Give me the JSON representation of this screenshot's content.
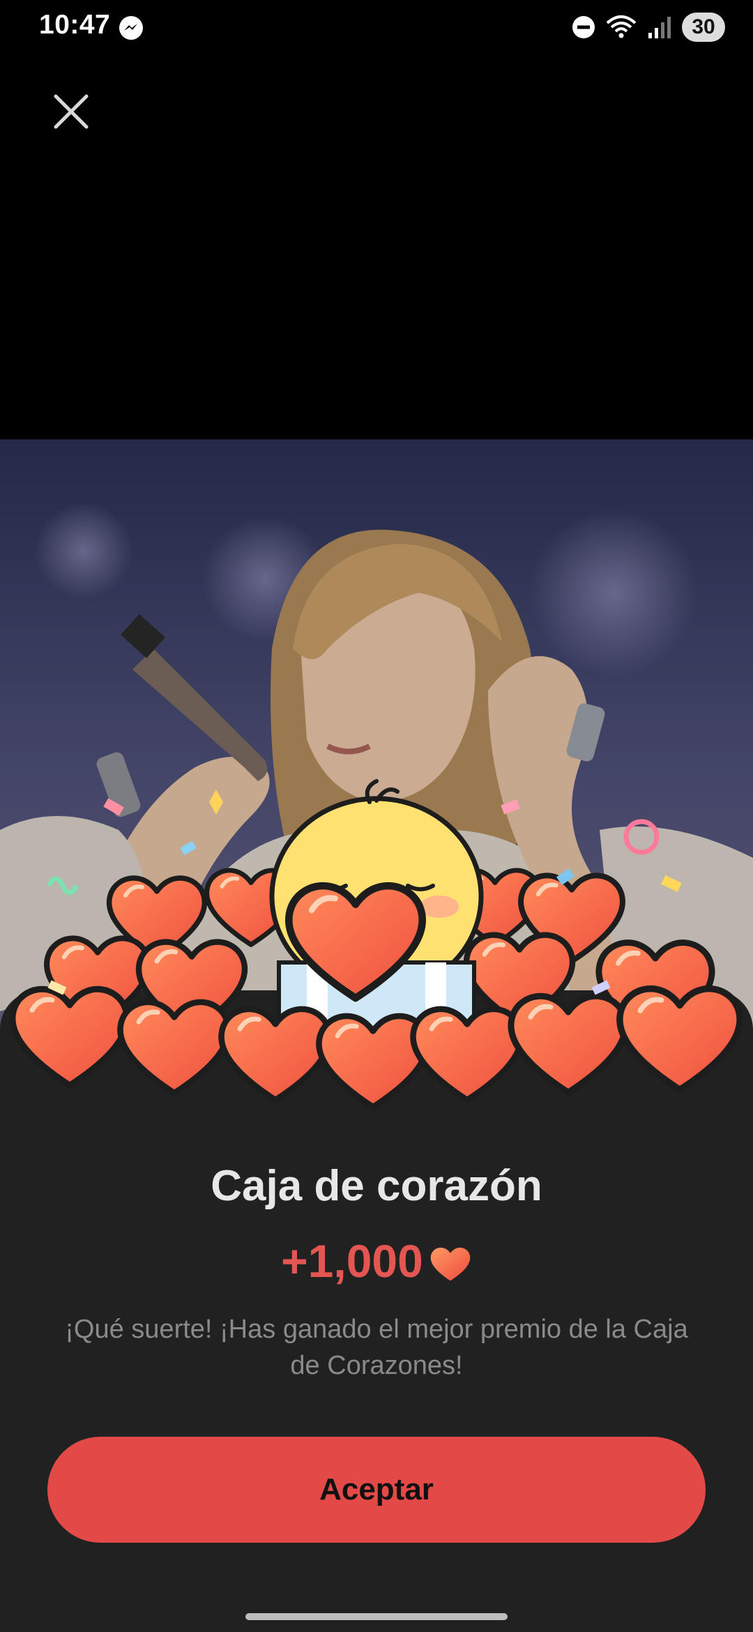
{
  "status_bar": {
    "time": "10:47",
    "battery": "30",
    "icons": [
      "messenger-icon",
      "do-not-disturb-icon",
      "wifi-icon",
      "signal-icon",
      "battery-icon"
    ]
  },
  "close_icon": "close-icon",
  "hero": {
    "image": "concert-photo",
    "overlay": "chick-mascot-with-hearts"
  },
  "reward_sheet": {
    "title": "Caja de corazón",
    "reward_value": "+1,000",
    "reward_icon": "heart-icon",
    "description": "¡Qué suerte! ¡Has ganado el mejor premio de la Caja de Corazones!",
    "accept_label": "Aceptar"
  },
  "colors": {
    "accent": "#e34a47",
    "sheet_bg": "#212121",
    "reward_text": "#e45651"
  }
}
